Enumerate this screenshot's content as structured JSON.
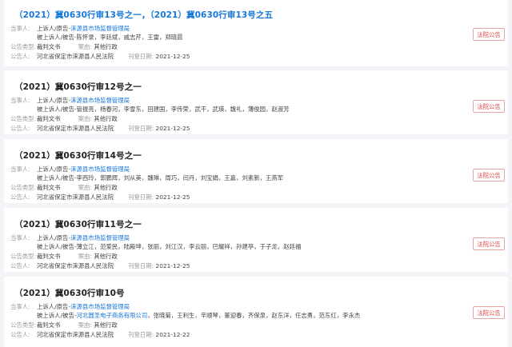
{
  "labels": {
    "party": "当事人:",
    "appellant": "上诉人/原告-",
    "appellee": "被上诉人/被告-",
    "type": "公告类型:",
    "cause": "案由:",
    "notifier": "公告人:",
    "date": "刊登日期:"
  },
  "notices": [
    {
      "title": "（2021）冀0630行审13号之一，（2021）冀0630行审13号之五",
      "appellant": "涞源县市场监督管理局",
      "appellee_plain": "",
      "appellee_rest": "陈怀录，李廷斌，戚志芹，王雷，郑晓晨",
      "notice_type": "裁判文书",
      "cause": "其他行政",
      "notifier": "河北省保定市涞源县人民法院",
      "date": "2021-12-25",
      "badge": "法院公告"
    },
    {
      "title": "（2021）冀0630行审12号之一",
      "appellant": "涞源县市场监督管理局",
      "appellee_plain": "",
      "appellee_rest": "管振亮，杨春河，李雪东，田建国，李传荣，武干，武瑛，魏礼，薄俊园，赵淑芳",
      "notice_type": "裁判文书",
      "cause": "其他行政",
      "notifier": "河北省保定市涞源县人民法院",
      "date": "2021-12-25",
      "badge": "法院公告"
    },
    {
      "title": "（2021）冀0630行审14号之一",
      "appellant": "涞源县市场监督管理局",
      "appellee_plain": "",
      "appellee_rest": "李西玲，郭鹏辉，刘从美，魏琳，周巧，闫丹，刘宝娟，王嘉，刘素新，王燕军",
      "notice_type": "裁判文书",
      "cause": "其他行政",
      "notifier": "河北省保定市涞源县人民法院",
      "date": "2021-12-25",
      "badge": "法院公告"
    },
    {
      "title": "（2021）冀0630行审11号之一",
      "appellant": "涞源县市场监督管理局",
      "appellee_plain": "",
      "appellee_rest": "薄立江，范爱民，陆殿坤，张丽，刘江汉，李云丽，巴耀祥，孙建亭，于子龙，赵廷福",
      "notice_type": "裁判文书",
      "cause": "其他行政",
      "notifier": "河北省保定市涞源县人民法院",
      "date": "2021-12-25",
      "badge": "法院公告"
    },
    {
      "title": "（2021）冀0630行审10号",
      "appellant": "涞源县市场监督管理局",
      "appellee_link": "河北圆圣电子商务有限公司",
      "appellee_rest": "，张晓菊，王利生，辛顺琴，董迎春，齐保泉，赵东洋，任志勇，范东红，李永杰",
      "notice_type": "裁判文书",
      "cause": "其他行政",
      "notifier": "河北省保定市涞源县人民法院",
      "date": "2021-12-22",
      "badge": "法院公告"
    }
  ]
}
